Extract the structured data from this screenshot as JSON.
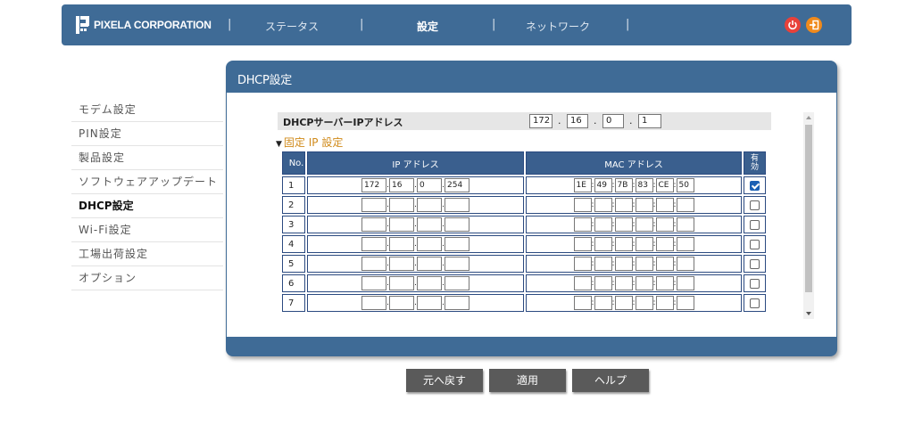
{
  "header": {
    "brand": "PIXELA CORPORATION",
    "nav": [
      {
        "label": "ステータス",
        "active": false
      },
      {
        "label": "設定",
        "active": true
      },
      {
        "label": "ネットワーク",
        "active": false
      }
    ],
    "separator": "|",
    "icons": [
      "power-icon",
      "logout-icon"
    ],
    "colors": {
      "bar": "#3f6b96",
      "power": "#e8413a",
      "logout": "#f08a1c"
    }
  },
  "sidebar": {
    "items": [
      {
        "label": "モデム設定"
      },
      {
        "label": "PIN設定"
      },
      {
        "label": "製品設定"
      },
      {
        "label": "ソフトウェアアップデート"
      },
      {
        "label": "DHCP設定",
        "active": true
      },
      {
        "label": "Wi-Fi設定"
      },
      {
        "label": "工場出荷設定"
      },
      {
        "label": "オプション"
      }
    ]
  },
  "panel": {
    "title": "DHCP設定",
    "server": {
      "label": "DHCPサーバーIPアドレス",
      "octets": [
        "172",
        "16",
        "0",
        "1"
      ],
      "dot": "."
    },
    "section_title": "固定 IP 設定",
    "section_toggle": "▼",
    "table": {
      "headers": {
        "no": "No.",
        "ip": "IP アドレス",
        "mac": "MAC アドレス",
        "enabled": "有効"
      },
      "rows": [
        {
          "no": "1",
          "ip": [
            "172",
            "16",
            "0",
            "254"
          ],
          "mac": [
            "1E",
            "49",
            "7B",
            "83",
            "CE",
            "50"
          ],
          "enabled": true
        },
        {
          "no": "2",
          "ip": [
            "",
            "",
            "",
            ""
          ],
          "mac": [
            "",
            "",
            "",
            "",
            "",
            ""
          ],
          "enabled": false
        },
        {
          "no": "3",
          "ip": [
            "",
            "",
            "",
            ""
          ],
          "mac": [
            "",
            "",
            "",
            "",
            "",
            ""
          ],
          "enabled": false
        },
        {
          "no": "4",
          "ip": [
            "",
            "",
            "",
            ""
          ],
          "mac": [
            "",
            "",
            "",
            "",
            "",
            ""
          ],
          "enabled": false
        },
        {
          "no": "5",
          "ip": [
            "",
            "",
            "",
            ""
          ],
          "mac": [
            "",
            "",
            "",
            "",
            "",
            ""
          ],
          "enabled": false
        },
        {
          "no": "6",
          "ip": [
            "",
            "",
            "",
            ""
          ],
          "mac": [
            "",
            "",
            "",
            "",
            "",
            ""
          ],
          "enabled": false
        },
        {
          "no": "7",
          "ip": [
            "",
            "",
            "",
            ""
          ],
          "mac": [
            "",
            "",
            "",
            "",
            "",
            ""
          ],
          "enabled": false
        }
      ],
      "ip_sep": ".",
      "mac_sep": ":"
    }
  },
  "buttons": {
    "back": "元へ戻す",
    "apply": "適用",
    "help": "ヘルプ"
  }
}
